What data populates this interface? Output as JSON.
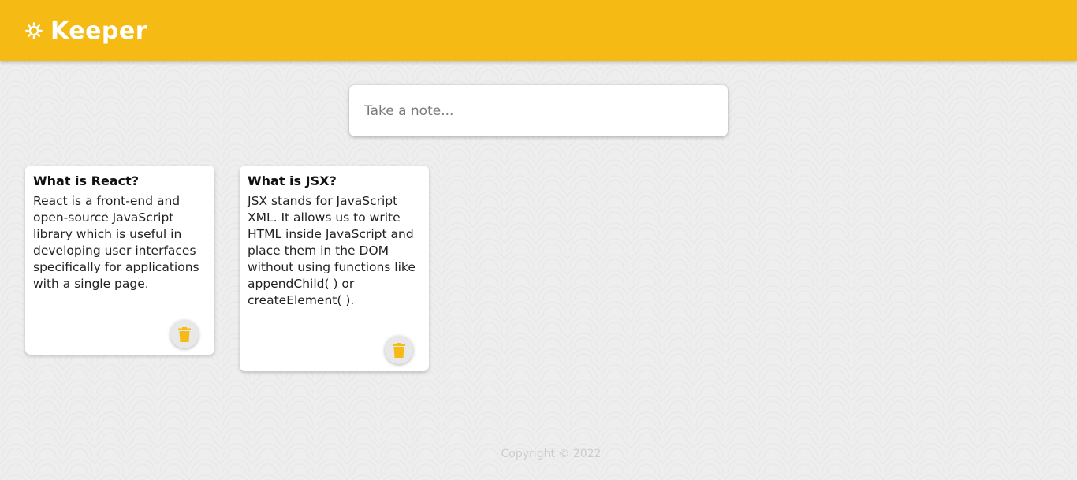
{
  "header": {
    "title": "Keeper",
    "icon": "lightbulb-icon",
    "background_color": "#f5ba13"
  },
  "create_note": {
    "placeholder": "Take a note..."
  },
  "notes": [
    {
      "title": "What is React?",
      "content": "React is a front-end and open-source JavaScript library which is useful in developing user interfaces specifically for applications with a single page.",
      "delete_icon": "trash-icon"
    },
    {
      "title": "What is JSX?",
      "content": "JSX stands for JavaScript XML. It allows us to write HTML inside JavaScript and place them in the DOM without using functions like appendChild( ) or createElement( ).",
      "delete_icon": "trash-icon"
    }
  ],
  "footer": {
    "text": "Copyright © 2022"
  },
  "colors": {
    "accent": "#f5ba13",
    "card": "#ffffff",
    "background": "#eeeeee"
  }
}
